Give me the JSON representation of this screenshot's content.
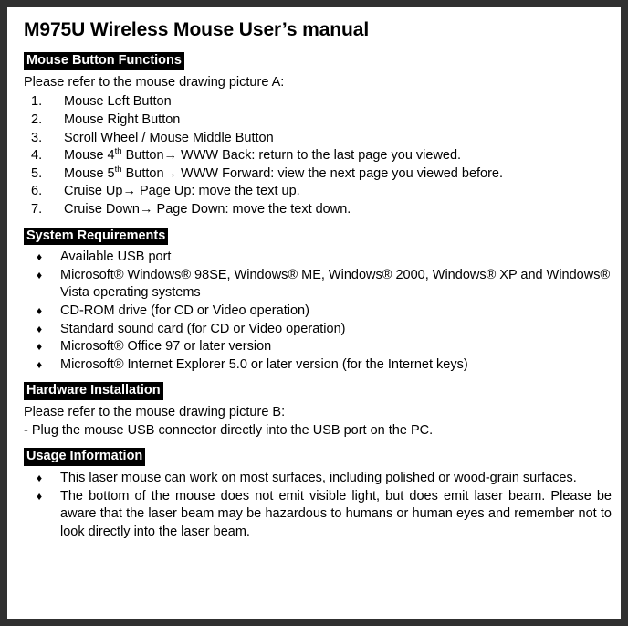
{
  "document": {
    "title": "M975U Wireless Mouse User’s manual",
    "sections": [
      {
        "heading": "Mouse Button Functions",
        "intro": "Please refer to the mouse drawing picture A:",
        "numbered_items": [
          {
            "num": "1.",
            "text": "Mouse Left Button"
          },
          {
            "num": "2.",
            "text": "Mouse Right Button"
          },
          {
            "num": "3.",
            "text": "Scroll Wheel / Mouse Middle Button"
          },
          {
            "num": "4.",
            "prefix": "Mouse 4",
            "sup": "th",
            "suffix": " Button",
            "arrow": "→",
            "rest": " WWW Back: return to the last page you viewed."
          },
          {
            "num": "5.",
            "prefix": "Mouse 5",
            "sup": "th",
            "suffix": " Button",
            "arrow": "→",
            "rest": " WWW Forward: view the next page you viewed before."
          },
          {
            "num": "6.",
            "prefix": "Cruise Up",
            "arrow": "→",
            "rest": " Page Up: move the text up."
          },
          {
            "num": "7.",
            "prefix": "Cruise Down",
            "arrow": "→",
            "rest": " Page Down: move the text down."
          }
        ]
      },
      {
        "heading": "System Requirements",
        "bullets": [
          "Available USB port",
          "Microsoft® Windows® 98SE, Windows® ME, Windows® 2000, Windows® XP and Windows® Vista operating systems",
          "CD-ROM drive (for CD or Video operation)",
          "Standard sound card (for CD or Video operation)",
          "Microsoft® Office 97 or later version",
          "Microsoft® Internet Explorer 5.0 or later version (for the Internet keys)"
        ]
      },
      {
        "heading": "Hardware Installation",
        "intro": "Please refer to the mouse drawing picture B:",
        "note": "- Plug the mouse USB connector directly into the USB port on the PC."
      },
      {
        "heading": "Usage Information",
        "bullets": [
          "This laser mouse can work on most surfaces, including polished or wood-grain surfaces.",
          "The bottom of the mouse does not emit visible light, but does emit laser beam. Please be aware that the laser beam may be hazardous to humans or human eyes and remember not to look directly into the laser beam."
        ]
      }
    ],
    "bullet_glyph": "♦",
    "colors": {
      "page_background": "#ffffff",
      "border": "#303030",
      "text": "#000000",
      "heading_background": "#000000",
      "heading_text": "#ffffff"
    }
  }
}
